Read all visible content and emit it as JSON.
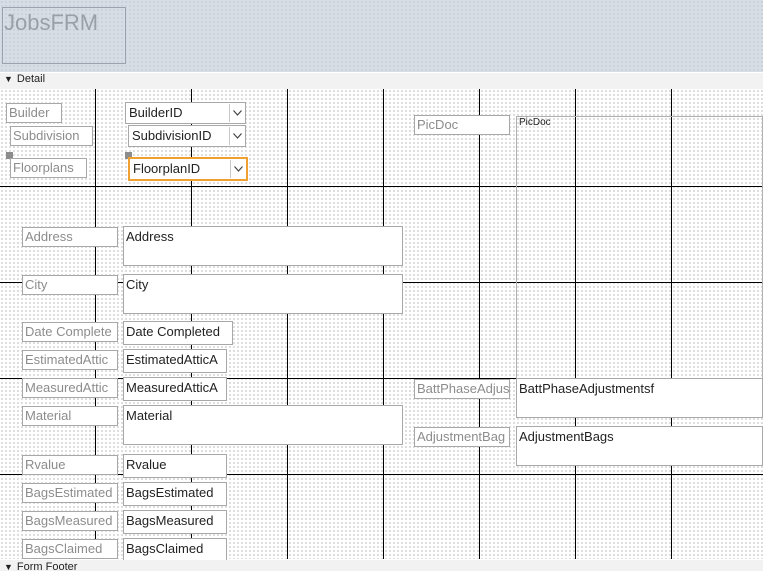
{
  "form": {
    "title": "JobsFRM"
  },
  "sections": {
    "detail": "Detail",
    "footer": "Form Footer"
  },
  "labels": {
    "builder": "Builder",
    "subdivision": "Subdivision",
    "floorplans": "Floorplans",
    "picdoc": "PicDoc",
    "address": "Address",
    "city": "City",
    "date_completed": "Date Complete",
    "estimated_attic": "EstimatedAttic",
    "measured_attic": "MeasuredAttic",
    "material": "Material",
    "rvalue": "Rvalue",
    "bags_estimated": "BagsEstimated",
    "bags_measured": "BagsMeasured",
    "bags_claimed": "BagsClaimed",
    "batt_phase": "BattPhaseAdjus",
    "adjustment_bags": "AdjustmentBag"
  },
  "controls": {
    "builder_id": "BuilderID",
    "subdivision_id": "SubdivisionID",
    "floorplan_id": "FloorplanID",
    "picdoc": "PicDoc",
    "address": "Address",
    "city": "City",
    "date_completed": "Date Completed",
    "estimated_attic": "EstimatedAtticA",
    "measured_attic": "MeasuredAtticA",
    "material": "Material",
    "rvalue": "Rvalue",
    "bags_estimated": "BagsEstimated",
    "bags_measured": "BagsMeasured",
    "bags_claimed": "BagsClaimed",
    "batt_phase": "BattPhaseAdjustmentsf",
    "adjustment_bags": "AdjustmentBags"
  },
  "icons": {
    "section": "section-collapse-icon",
    "dropdown": "chevron-down-icon"
  },
  "colors": {
    "selection": "#f0a030",
    "header_bg": "#d7dde5"
  }
}
